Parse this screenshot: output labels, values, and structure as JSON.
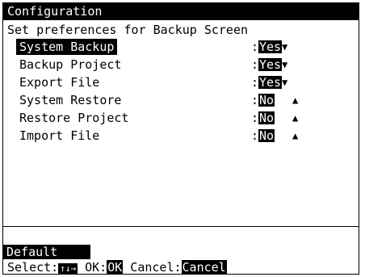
{
  "window": {
    "title": "Configuration"
  },
  "subtitle": "Set preferences for Backup Screen",
  "settings": [
    {
      "label": "System Backup",
      "value": "Yes",
      "arrow": "▼",
      "selected": true
    },
    {
      "label": "Backup Project",
      "value": "Yes",
      "arrow": "▼",
      "selected": false
    },
    {
      "label": "Export File",
      "value": "Yes",
      "arrow": "▼",
      "selected": false
    },
    {
      "label": "System Restore",
      "value": "No",
      "arrow": "▲",
      "selected": false
    },
    {
      "label": "Restore Project",
      "value": "No",
      "arrow": "▲",
      "selected": false
    },
    {
      "label": "Import File",
      "value": "No",
      "arrow": "▲",
      "selected": false
    }
  ],
  "separator": ":",
  "footer": {
    "default_label": "Default",
    "select_label": "Select:",
    "select_keys": "↑↓→",
    "ok_label": " OK:",
    "ok_key": "OK",
    "cancel_label": " Cancel:",
    "cancel_key": "Cancel"
  }
}
